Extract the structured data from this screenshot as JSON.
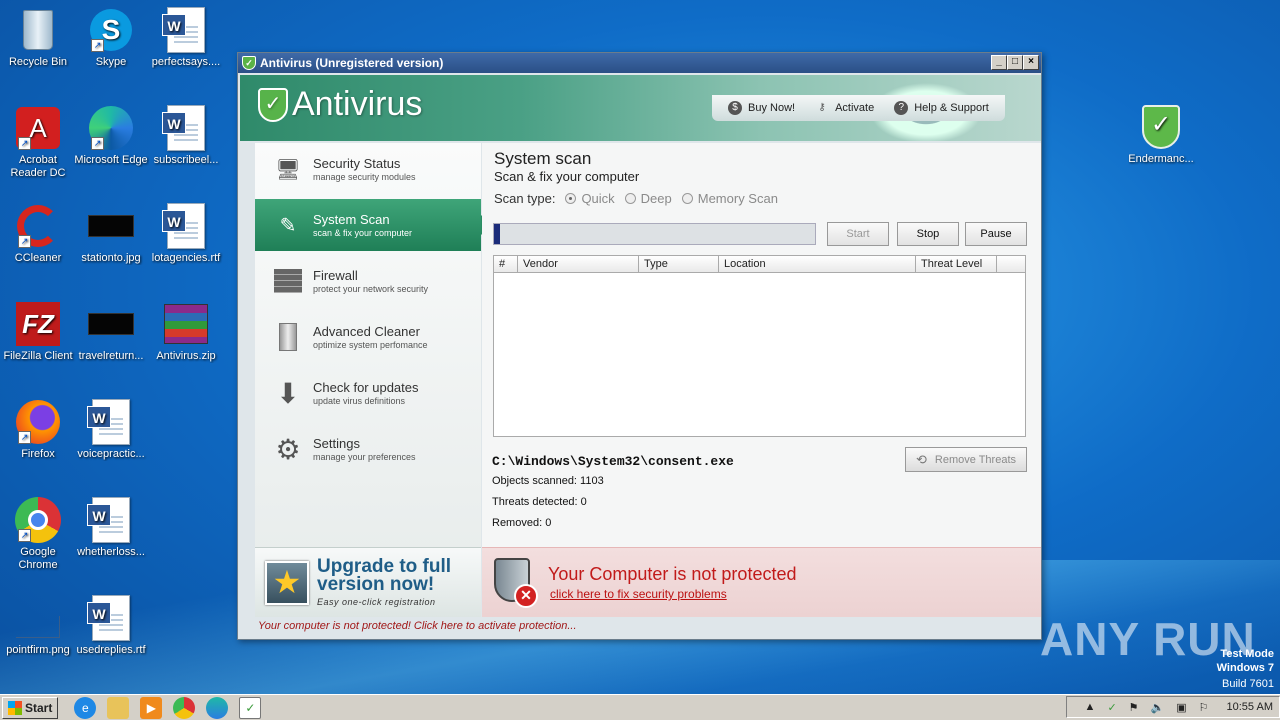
{
  "desktop": {
    "icons": [
      {
        "label": "Recycle Bin"
      },
      {
        "label": "Skype"
      },
      {
        "label": "perfectsays...."
      },
      {
        "label": "Acrobat Reader DC"
      },
      {
        "label": "Microsoft Edge"
      },
      {
        "label": "subscribeel..."
      },
      {
        "label": "CCleaner"
      },
      {
        "label": "stationto.jpg"
      },
      {
        "label": "lotagencies.rtf"
      },
      {
        "label": "FileZilla Client"
      },
      {
        "label": "travelreturn..."
      },
      {
        "label": "Antivirus.zip"
      },
      {
        "label": "Firefox"
      },
      {
        "label": "voicepractic..."
      },
      {
        "label": "Google Chrome"
      },
      {
        "label": "whetherloss..."
      },
      {
        "label": "pointfirm.png"
      },
      {
        "label": "usedreplies.rtf"
      },
      {
        "label": "Endermanc..."
      }
    ],
    "watermark": {
      "line1": "Test Mode",
      "line2": "Windows 7",
      "line3": "Build 7601"
    },
    "anyrun": "ANY RUN"
  },
  "window": {
    "title": "Antivirus (Unregistered version)",
    "brand": "Antivirus",
    "topnav": {
      "buy": "Buy Now!",
      "activate": "Activate",
      "help": "Help & Support"
    },
    "nav": [
      {
        "title": "Security Status",
        "sub": "manage security modules"
      },
      {
        "title": "System Scan",
        "sub": "scan & fix your computer"
      },
      {
        "title": "Firewall",
        "sub": "protect your network security"
      },
      {
        "title": "Advanced Cleaner",
        "sub": "optimize system perfomance"
      },
      {
        "title": "Check for updates",
        "sub": "update virus definitions"
      },
      {
        "title": "Settings",
        "sub": "manage your preferences"
      }
    ],
    "upgrade": {
      "line1": "Upgrade to full",
      "line2": "version now!",
      "sub": "Easy one-click registration"
    },
    "main": {
      "title": "System scan",
      "subtitle": "Scan & fix your computer",
      "scan_type_label": "Scan type:",
      "scan_types": [
        "Quick",
        "Deep",
        "Memory Scan"
      ],
      "selected_scan_type": "Quick",
      "progress": 0.02,
      "buttons": {
        "start": "Start",
        "stop": "Stop",
        "pause": "Pause",
        "remove": "Remove Threats"
      },
      "columns": [
        "#",
        "Vendor",
        "Type",
        "Location",
        "Threat Level"
      ],
      "current_file": "C:\\Windows\\System32\\consent.exe",
      "objects_scanned": "Objects scanned: 1103",
      "threats_detected": "Threats detected: 0",
      "removed": "Removed: 0"
    },
    "alert": {
      "title": "Your Computer is not protected",
      "link": "click here to fix security problems"
    },
    "status_line": "Your computer is not protected! Click here to activate protection..."
  },
  "taskbar": {
    "start": "Start",
    "time": "10:55 AM"
  }
}
